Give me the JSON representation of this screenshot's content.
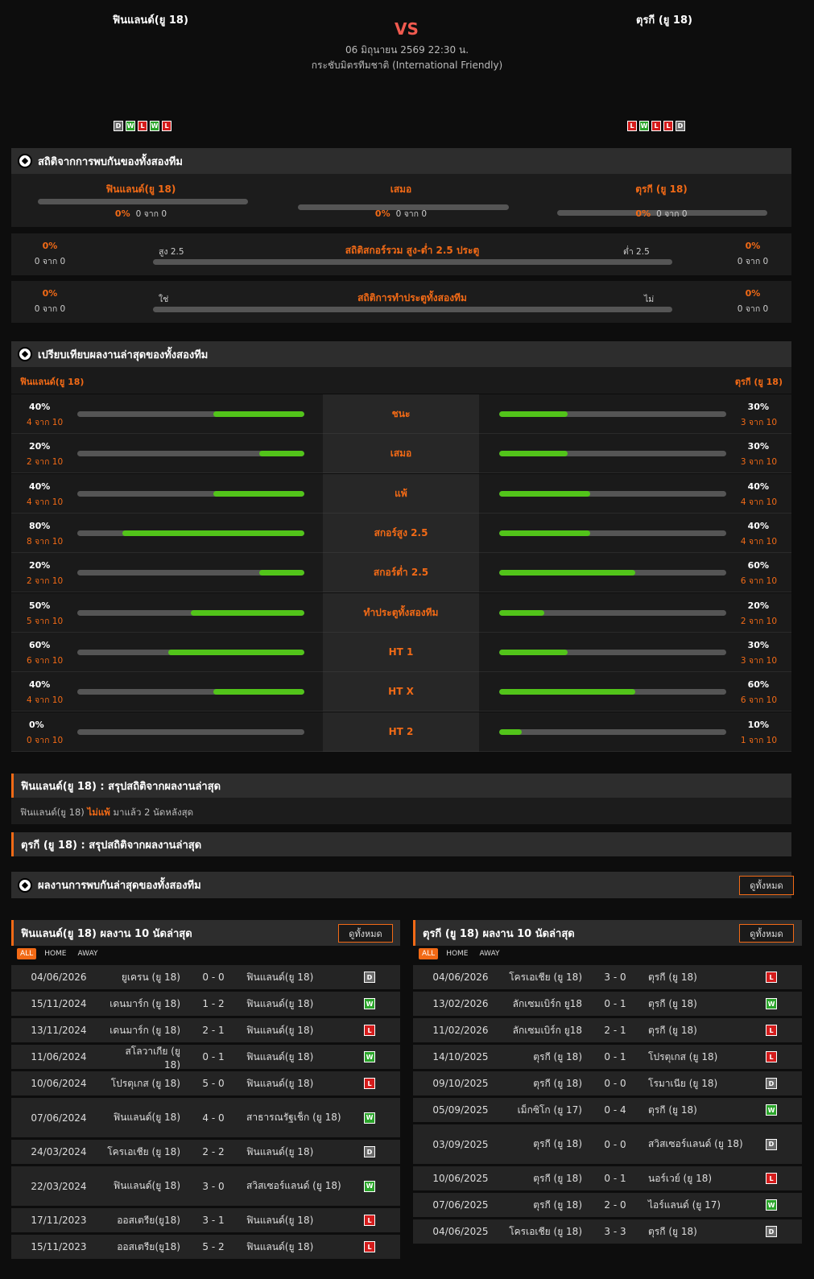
{
  "header": {
    "home": "ฟินแลนด์(ยู 18)",
    "away": "ตุรกี (ยู 18)",
    "vs": "VS",
    "datetime": "06 มิถุนายน 2569 22:30 น.",
    "competition": "กระชับมิตรทีมชาติ (International Friendly)",
    "home_form": [
      "D",
      "W",
      "L",
      "W",
      "L"
    ],
    "away_form": [
      "L",
      "W",
      "L",
      "L",
      "D"
    ]
  },
  "h2h": {
    "title": "สถิติจากการพบกันของทั้งสองทีม",
    "home": "ฟินแลนด์(ยู 18)",
    "draw": "เสมอ",
    "away": "ตุรกี (ยู 18)",
    "home_pct": "0%",
    "home_cnt": "0 จาก 0",
    "draw_pct": "0%",
    "draw_cnt": "0 จาก 0",
    "away_pct": "0%",
    "away_cnt": "0 จาก 0",
    "ou": {
      "title": "สถิติสกอร์รวม สูง-ต่ำ 2.5 ประตู",
      "left_label": "สูง 2.5",
      "right_label": "ต่ำ 2.5",
      "lpct": "0%",
      "lcnt": "0 จาก 0",
      "rpct": "0%",
      "rcnt": "0 จาก 0"
    },
    "btts": {
      "title": "สถิติการทำประตูทั้งสองทีม",
      "left_label": "ใช่",
      "right_label": "ไม่",
      "lpct": "0%",
      "lcnt": "0 จาก 0",
      "rpct": "0%",
      "rcnt": "0 จาก 0"
    }
  },
  "compare": {
    "title": "เปรียบเทียบผลงานล่าสุดของทั้งสองทีม",
    "home": "ฟินแลนด์(ยู 18)",
    "away": "ตุรกี (ยู 18)",
    "rows": [
      {
        "label": "ชนะ",
        "lpct": "40%",
        "lcnt": "4 จาก 10",
        "lv": 0.4,
        "rpct": "30%",
        "rcnt": "3 จาก 10",
        "rv": 0.3
      },
      {
        "label": "เสมอ",
        "lpct": "20%",
        "lcnt": "2 จาก 10",
        "lv": 0.2,
        "rpct": "30%",
        "rcnt": "3 จาก 10",
        "rv": 0.3
      },
      {
        "label": "แพ้",
        "lpct": "40%",
        "lcnt": "4 จาก 10",
        "lv": 0.4,
        "rpct": "40%",
        "rcnt": "4 จาก 10",
        "rv": 0.4
      },
      {
        "label": "สกอร์สูง 2.5",
        "lpct": "80%",
        "lcnt": "8 จาก 10",
        "lv": 0.8,
        "rpct": "40%",
        "rcnt": "4 จาก 10",
        "rv": 0.4
      },
      {
        "label": "สกอร์ต่ำ 2.5",
        "lpct": "20%",
        "lcnt": "2 จาก 10",
        "lv": 0.2,
        "rpct": "60%",
        "rcnt": "6 จาก 10",
        "rv": 0.6
      },
      {
        "label": "ทำประตูทั้งสองทีม",
        "lpct": "50%",
        "lcnt": "5 จาก 10",
        "lv": 0.5,
        "rpct": "20%",
        "rcnt": "2 จาก 10",
        "rv": 0.2
      },
      {
        "label": "HT 1",
        "lpct": "60%",
        "lcnt": "6 จาก 10",
        "lv": 0.6,
        "rpct": "30%",
        "rcnt": "3 จาก 10",
        "rv": 0.3
      },
      {
        "label": "HT X",
        "lpct": "40%",
        "lcnt": "4 จาก 10",
        "lv": 0.4,
        "rpct": "60%",
        "rcnt": "6 จาก 10",
        "rv": 0.6
      },
      {
        "label": "HT 2",
        "lpct": "0%",
        "lcnt": "0 จาก 10",
        "lv": 0,
        "rpct": "10%",
        "rcnt": "1 จาก 10",
        "rv": 0.1
      }
    ]
  },
  "summary": {
    "home_title": "ฟินแลนด์(ยู 18) : สรุปสถิติจากผลงานล่าสุด",
    "home_pre": "ฟินแลนด์(ยู 18)",
    "home_hl": "ไม่แพ้",
    "home_post": "มาแล้ว 2 นัดหลังสุด",
    "away_title": "ตุรกี (ยู 18) : สรุปสถิติจากผลงานล่าสุด"
  },
  "recent_h2h": {
    "title": "ผลงานการพบกันล่าสุดของทั้งสองทีม",
    "button": "ดูทั้งหมด"
  },
  "home_last": {
    "title": "ฟินแลนด์(ยู 18) ผลงาน 10 นัดล่าสุด",
    "button": "ดูทั้งหมด",
    "tabs": [
      "ALL",
      "HOME",
      "AWAY"
    ],
    "rows": [
      {
        "date": "04/06/2026",
        "home": "ยูเครน (ยู 18)",
        "score": "0 - 0",
        "away": "ฟินแลนด์(ยู 18)",
        "res": "D"
      },
      {
        "date": "15/11/2024",
        "home": "เดนมาร์ก (ยู 18)",
        "score": "1 - 2",
        "away": "ฟินแลนด์(ยู 18)",
        "res": "W"
      },
      {
        "date": "13/11/2024",
        "home": "เดนมาร์ก (ยู 18)",
        "score": "2 - 1",
        "away": "ฟินแลนด์(ยู 18)",
        "res": "L"
      },
      {
        "date": "11/06/2024",
        "home": "สโลวาเกีย (ยู 18)",
        "score": "0 - 1",
        "away": "ฟินแลนด์(ยู 18)",
        "res": "W"
      },
      {
        "date": "10/06/2024",
        "home": "โปรตุเกส (ยู 18)",
        "score": "5 - 0",
        "away": "ฟินแลนด์(ยู 18)",
        "res": "L"
      },
      {
        "date": "07/06/2024",
        "home": "ฟินแลนด์(ยู 18)",
        "score": "4 - 0",
        "away": "สาธารณรัฐเช็ก (ยู 18)",
        "res": "W"
      },
      {
        "date": "24/03/2024",
        "home": "โครเอเชีย (ยู 18)",
        "score": "2 - 2",
        "away": "ฟินแลนด์(ยู 18)",
        "res": "D"
      },
      {
        "date": "22/03/2024",
        "home": "ฟินแลนด์(ยู 18)",
        "score": "3 - 0",
        "away": "สวิสเซอร์แลนด์ (ยู 18)",
        "res": "W"
      },
      {
        "date": "17/11/2023",
        "home": "ออสเตรีย(ยู18)",
        "score": "3 - 1",
        "away": "ฟินแลนด์(ยู 18)",
        "res": "L"
      },
      {
        "date": "15/11/2023",
        "home": "ออสเตรีย(ยู18)",
        "score": "5 - 2",
        "away": "ฟินแลนด์(ยู 18)",
        "res": "L"
      }
    ]
  },
  "away_last": {
    "title": "ตุรกี (ยู 18) ผลงาน 10 นัดล่าสุด",
    "button": "ดูทั้งหมด",
    "tabs": [
      "ALL",
      "HOME",
      "AWAY"
    ],
    "rows": [
      {
        "date": "04/06/2026",
        "home": "โครเอเชีย (ยู 18)",
        "score": "3 - 0",
        "away": "ตุรกี (ยู 18)",
        "res": "L"
      },
      {
        "date": "13/02/2026",
        "home": "ลักเซมเบิร์ก ยู18",
        "score": "0 - 1",
        "away": "ตุรกี (ยู 18)",
        "res": "W"
      },
      {
        "date": "11/02/2026",
        "home": "ลักเซมเบิร์ก ยู18",
        "score": "2 - 1",
        "away": "ตุรกี (ยู 18)",
        "res": "L"
      },
      {
        "date": "14/10/2025",
        "home": "ตุรกี (ยู 18)",
        "score": "0 - 1",
        "away": "โปรตุเกส (ยู 18)",
        "res": "L"
      },
      {
        "date": "09/10/2025",
        "home": "ตุรกี (ยู 18)",
        "score": "0 - 0",
        "away": "โรมาเนีย (ยู 18)",
        "res": "D"
      },
      {
        "date": "05/09/2025",
        "home": "เม็กซิโก (ยู 17)",
        "score": "0 - 4",
        "away": "ตุรกี (ยู 18)",
        "res": "W"
      },
      {
        "date": "03/09/2025",
        "home": "ตุรกี (ยู 18)",
        "score": "0 - 0",
        "away": "สวิสเซอร์แลนด์ (ยู 18)",
        "res": "D"
      },
      {
        "date": "10/06/2025",
        "home": "ตุรกี (ยู 18)",
        "score": "0 - 1",
        "away": "นอร์เวย์ (ยู 18)",
        "res": "L"
      },
      {
        "date": "07/06/2025",
        "home": "ตุรกี (ยู 18)",
        "score": "2 - 0",
        "away": "ไอร์แลนด์ (ยู 17)",
        "res": "W"
      },
      {
        "date": "04/06/2025",
        "home": "โครเอเชีย (ยู 18)",
        "score": "3 - 3",
        "away": "ตุรกี (ยู 18)",
        "res": "D"
      }
    ]
  }
}
